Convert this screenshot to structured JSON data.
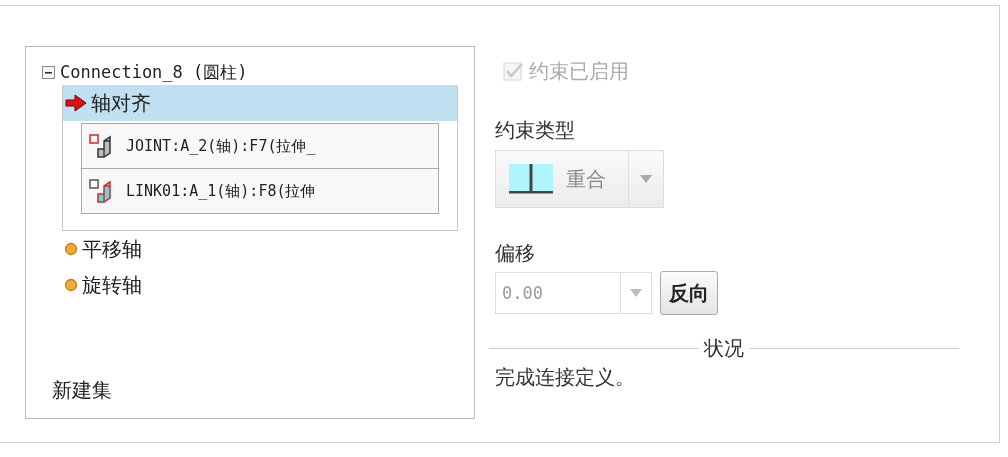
{
  "constraint_set": {
    "label": "Connection_8 (圆柱)",
    "expanded": true,
    "constraints": [
      {
        "label": "轴对齐",
        "selected": true,
        "references": [
          "JOINT:A_2(轴):F7(拉伸_",
          "LINK01:A_1(轴):F8(拉伸"
        ]
      },
      {
        "label": "平移轴",
        "selected": false
      },
      {
        "label": "旋转轴",
        "selected": false
      }
    ]
  },
  "new_set": "新建集",
  "enabled": {
    "label": "约束已启用",
    "checked": true,
    "disabled": true
  },
  "constraint_type": {
    "label": "约束类型",
    "value": "重合"
  },
  "offset": {
    "label": "偏移",
    "value": "0.00"
  },
  "flip_button": "反向",
  "status": {
    "heading": "状况",
    "message": "完成连接定义。"
  }
}
